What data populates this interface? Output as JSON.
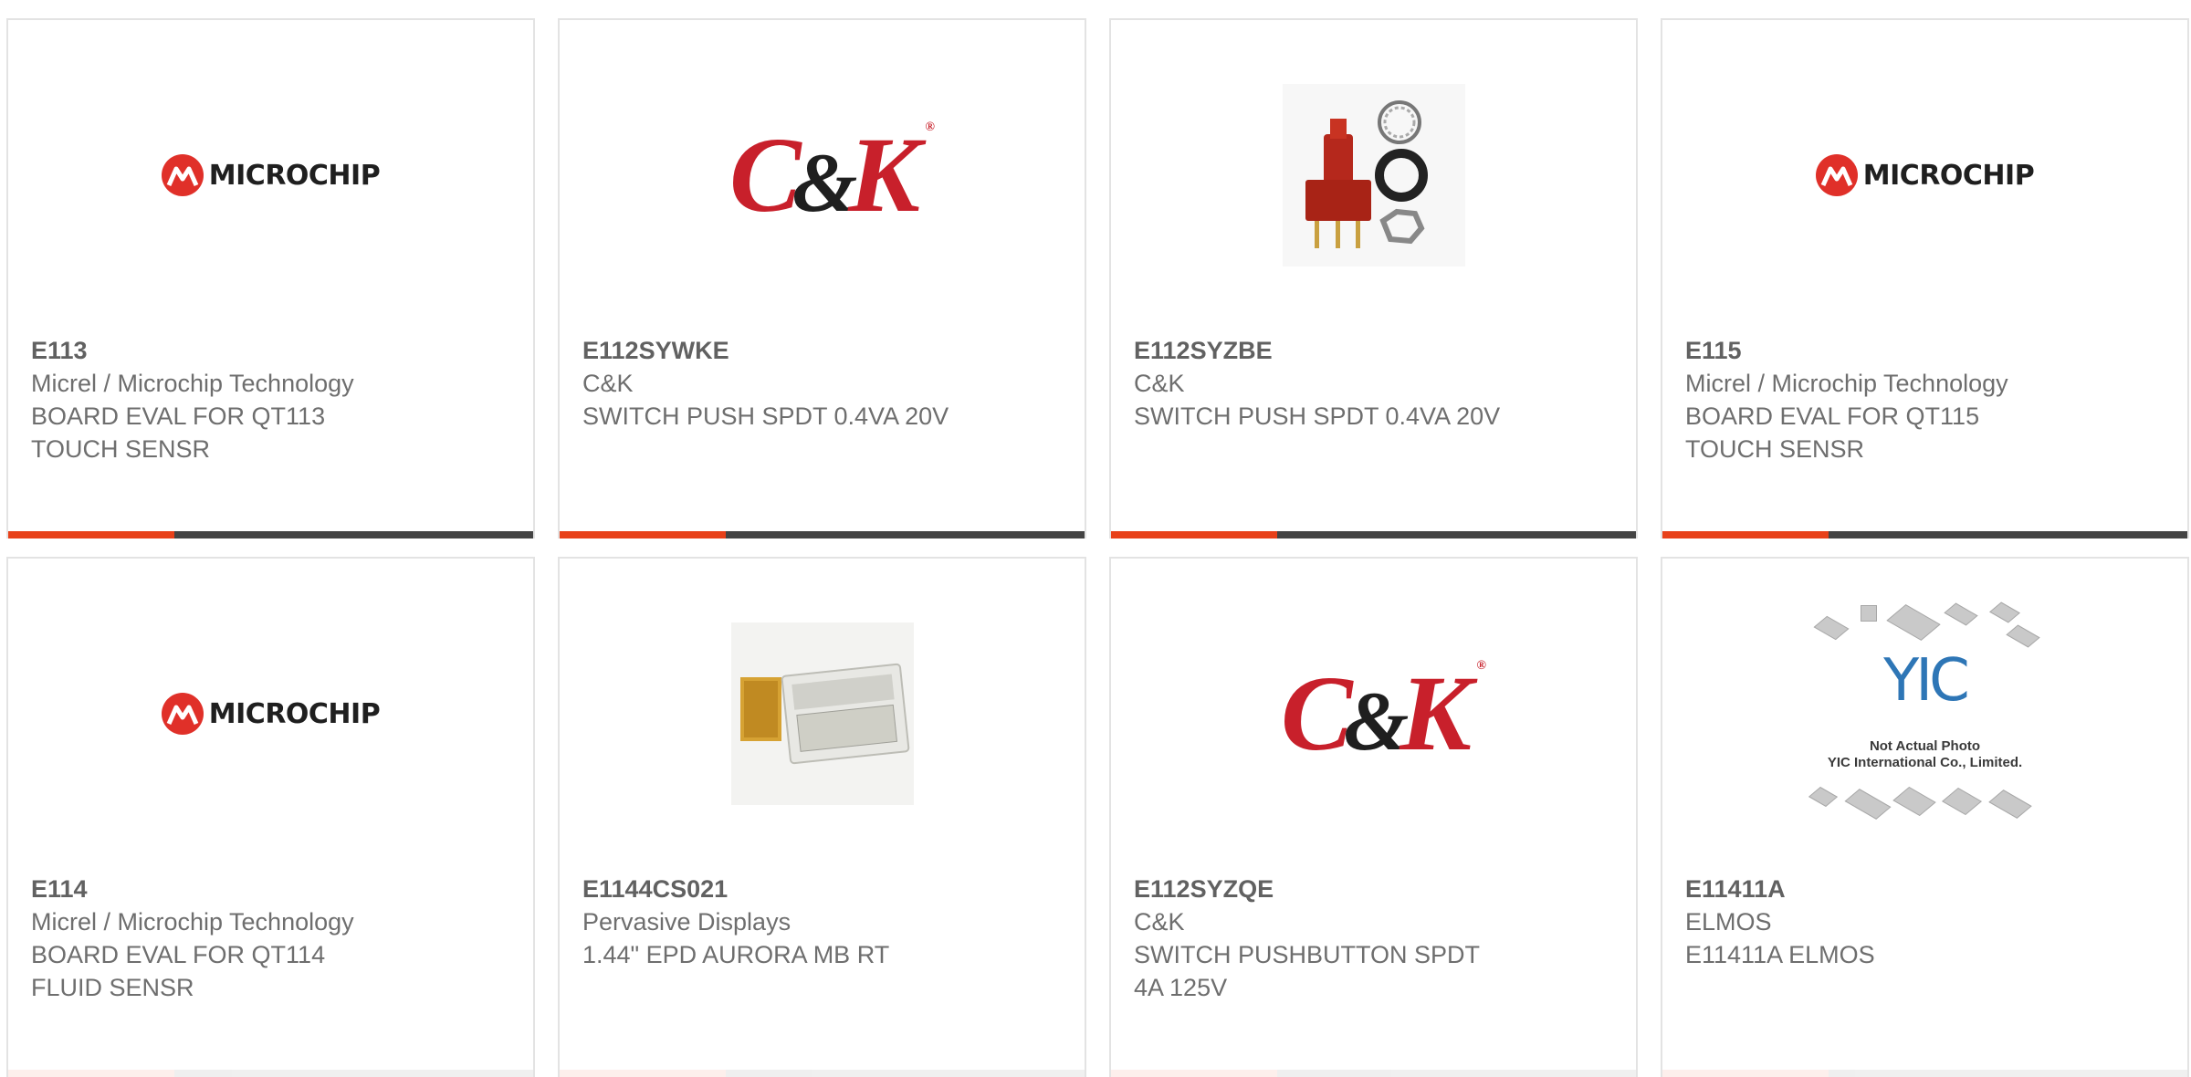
{
  "products": [
    {
      "part": "E113",
      "manufacturer": "Micrel / Microchip Technology",
      "desc1": "BOARD EVAL FOR QT113",
      "desc2": "TOUCH SENSR",
      "image": "microchip-logo"
    },
    {
      "part": "E112SYWKE",
      "manufacturer": "C&K",
      "desc1": "SWITCH PUSH SPDT 0.4VA 20V",
      "desc2": "",
      "image": "ck-logo"
    },
    {
      "part": "E112SYZBE",
      "manufacturer": "C&K",
      "desc1": "SWITCH PUSH SPDT 0.4VA 20V",
      "desc2": "",
      "image": "pushbutton-photo"
    },
    {
      "part": "E115",
      "manufacturer": "Micrel / Microchip Technology",
      "desc1": "BOARD EVAL FOR QT115",
      "desc2": "TOUCH SENSR",
      "image": "microchip-logo"
    },
    {
      "part": "E114",
      "manufacturer": "Micrel / Microchip Technology",
      "desc1": "BOARD EVAL FOR QT114",
      "desc2": "FLUID SENSR",
      "image": "microchip-logo"
    },
    {
      "part": "E1144CS021",
      "manufacturer": "Pervasive Displays",
      "desc1": "1.44\" EPD AURORA MB RT",
      "desc2": "",
      "image": "epd-photo"
    },
    {
      "part": "E112SYZQE",
      "manufacturer": "C&K",
      "desc1": "SWITCH PUSHBUTTON SPDT",
      "desc2": "4A 125V",
      "image": "ck-logo"
    },
    {
      "part": "E11411A",
      "manufacturer": "ELMOS",
      "desc1": "E11411A ELMOS",
      "desc2": "",
      "image": "yic-placeholder"
    }
  ],
  "logos": {
    "microchip_word": "MICROCHIP",
    "ck_c": "C",
    "ck_amp": "&",
    "ck_k": "K",
    "ck_tm": "®",
    "yic_brand": "YIC",
    "yic_note1": "Not Actual Photo",
    "yic_note2": "YIC International Co., Limited."
  },
  "colors": {
    "accent": "#e8411a",
    "bar": "#444444",
    "microchip_red": "#e03029",
    "ck_red": "#c8202b",
    "yic_blue": "#2e76b6"
  }
}
